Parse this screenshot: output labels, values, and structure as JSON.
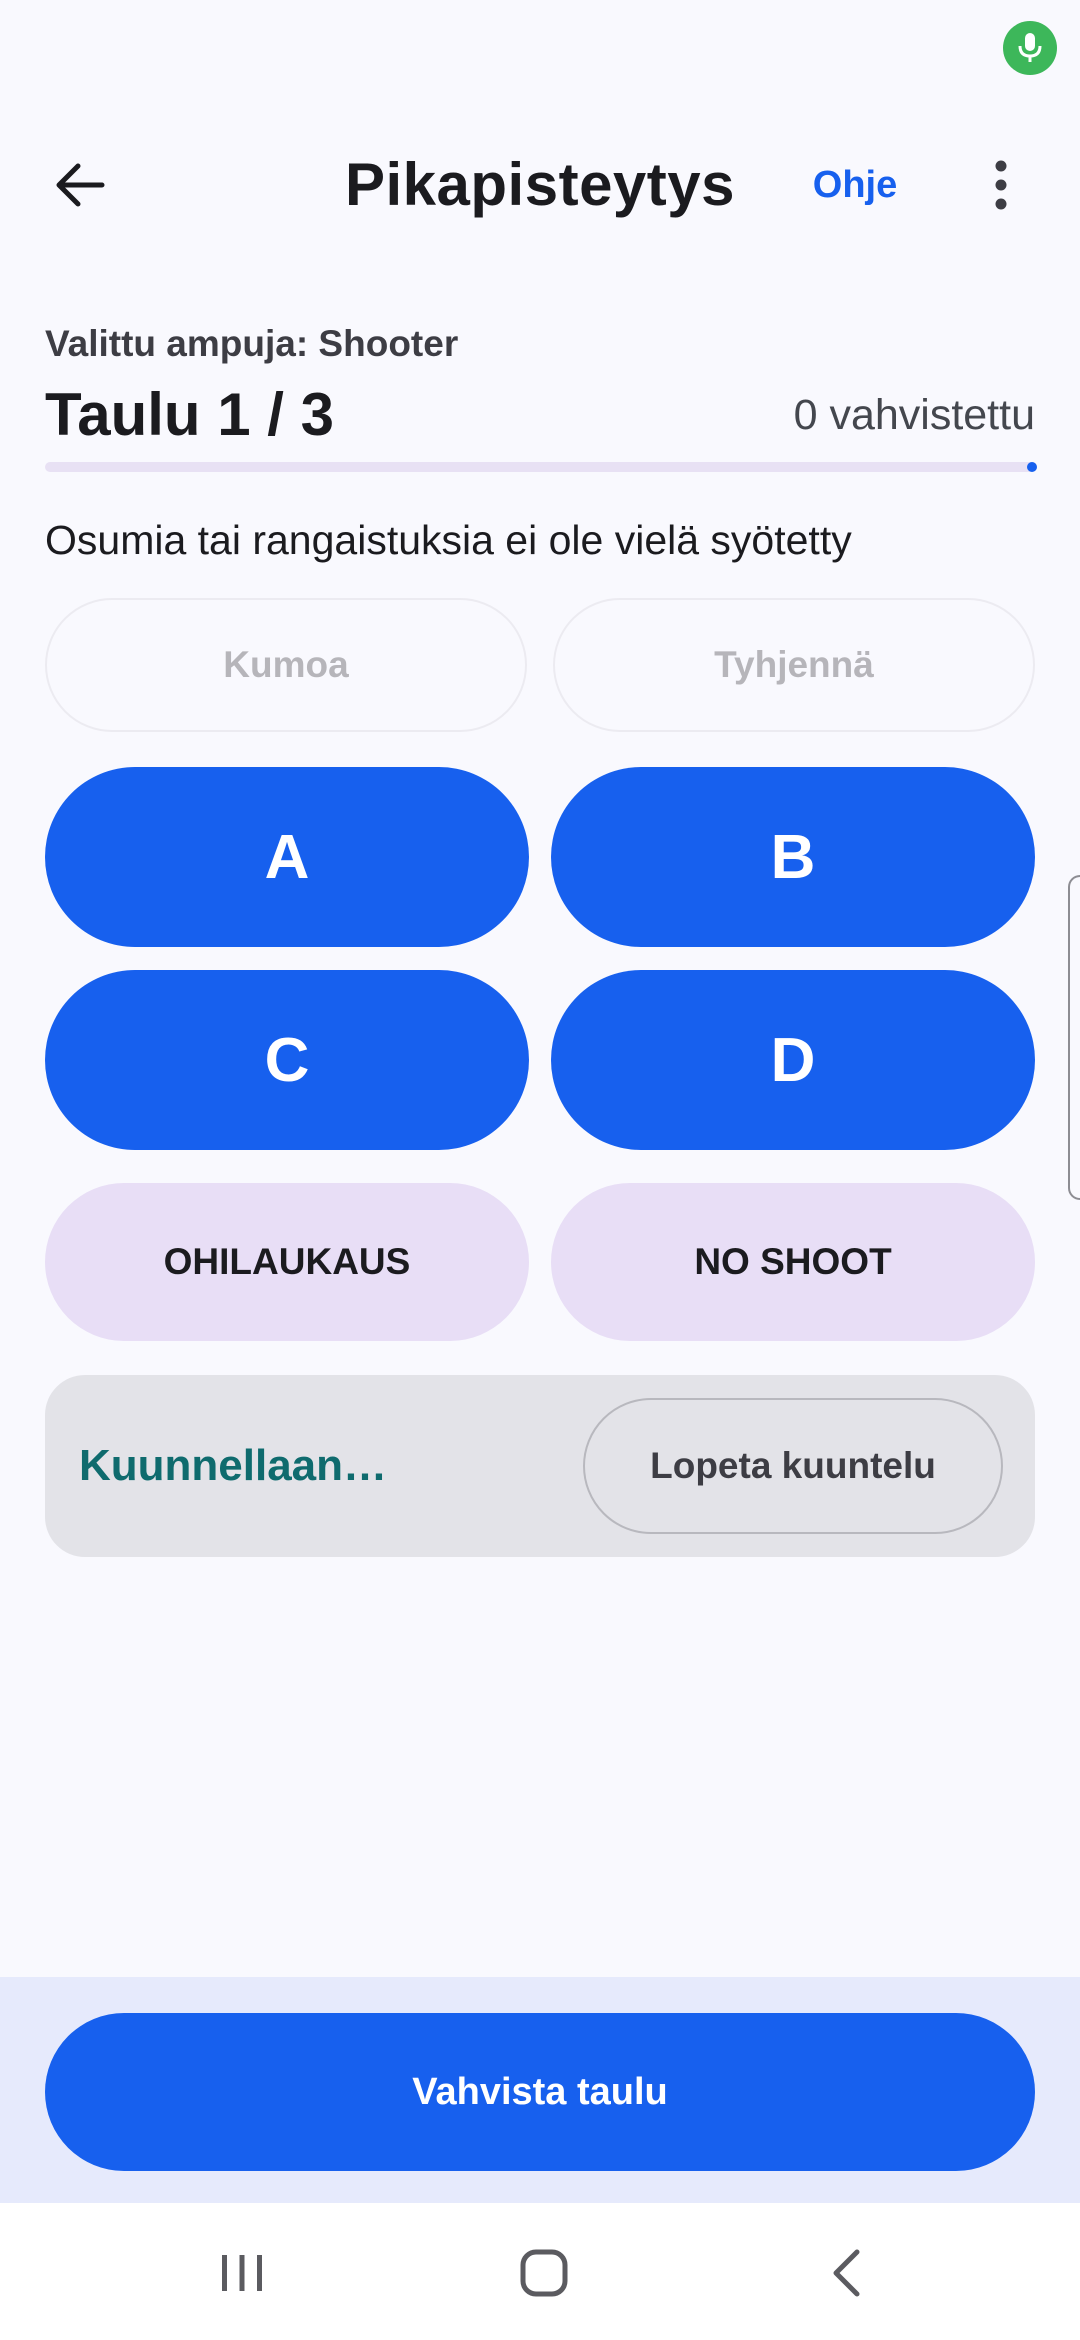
{
  "header": {
    "title": "Pikapisteytys",
    "help_label": "Ohje"
  },
  "shooter": {
    "selected_label": "Valittu ampuja: Shooter",
    "target_counter": "Taulu 1 / 3",
    "confirmed": "0 vahvistettu"
  },
  "progress": {
    "fraction": 0.0
  },
  "status": {
    "message": "Osumia tai rangaistuksia ei ole vielä syötetty"
  },
  "actions": {
    "undo_label": "Kumoa",
    "clear_label": "Tyhjennä"
  },
  "zones": {
    "a": "A",
    "b": "B",
    "c": "C",
    "d": "D",
    "miss": "OHILAUKAUS",
    "no_shoot": "NO SHOOT"
  },
  "listening": {
    "status": "Kuunnellaan…",
    "stop_label": "Lopeta kuuntelu"
  },
  "footer": {
    "confirm_label": "Vahvista taulu"
  },
  "icons": {
    "mic": "mic-icon",
    "back": "arrow-left-icon",
    "more": "more-vertical-icon",
    "recents": "recents-icon",
    "home": "home-icon",
    "nav_back": "chevron-left-icon"
  },
  "colors": {
    "primary": "#1760ee",
    "tonal": "#e8def6",
    "listening_text": "#0f6b6e",
    "mic_indicator": "#3db75a"
  }
}
